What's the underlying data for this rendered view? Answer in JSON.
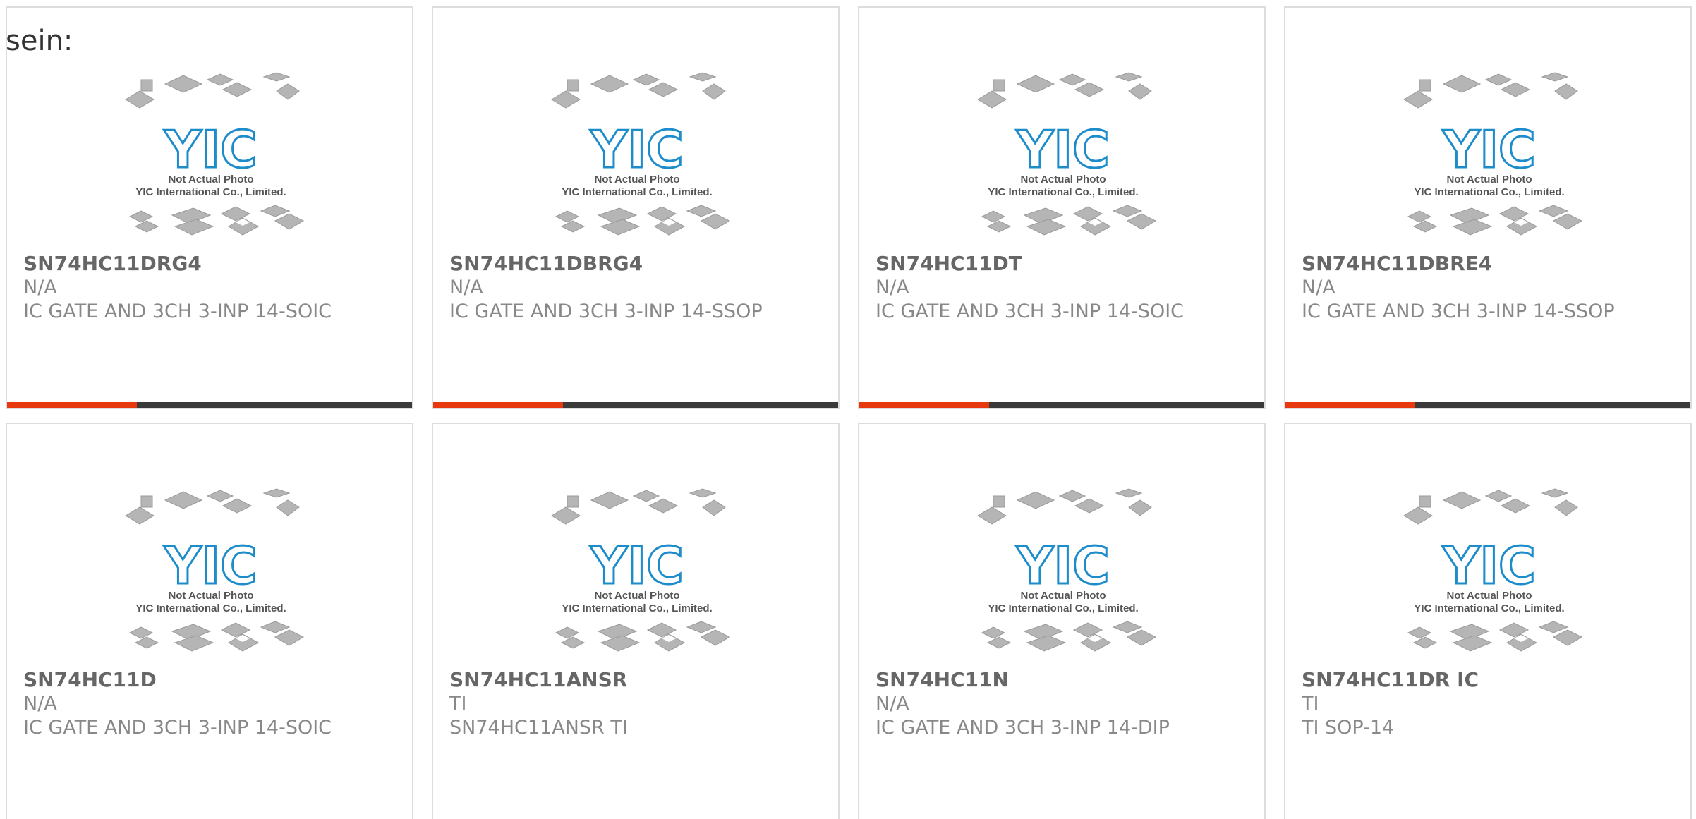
{
  "heading": "sein:",
  "placeholder": {
    "logo_text": "YIC",
    "line1": "Not Actual Photo",
    "line2": "YIC International Co., Limited."
  },
  "colors": {
    "accent": "#e8380d",
    "bar_dark": "#3a3a3a",
    "logo": "#1c8ccb"
  },
  "products": [
    {
      "part_number": "SN74HC11DRG4",
      "manufacturer": "N/A",
      "description": "IC GATE AND 3CH 3-INP 14-SOIC",
      "accent_fraction": 0.32
    },
    {
      "part_number": "SN74HC11DBRG4",
      "manufacturer": "N/A",
      "description": "IC GATE AND 3CH 3-INP 14-SSOP",
      "accent_fraction": 0.32
    },
    {
      "part_number": "SN74HC11DT",
      "manufacturer": "N/A",
      "description": "IC GATE AND 3CH 3-INP 14-SOIC",
      "accent_fraction": 0.32
    },
    {
      "part_number": "SN74HC11DBRE4",
      "manufacturer": "N/A",
      "description": "IC GATE AND 3CH 3-INP 14-SSOP",
      "accent_fraction": 0.32
    },
    {
      "part_number": "SN74HC11D",
      "manufacturer": "N/A",
      "description": "IC GATE AND 3CH 3-INP 14-SOIC"
    },
    {
      "part_number": "SN74HC11ANSR",
      "manufacturer": "TI",
      "description": "SN74HC11ANSR TI"
    },
    {
      "part_number": "SN74HC11N",
      "manufacturer": "N/A",
      "description": "IC GATE AND 3CH 3-INP 14-DIP"
    },
    {
      "part_number": "SN74HC11DR IC",
      "manufacturer": "TI",
      "description": "TI SOP-14"
    }
  ]
}
